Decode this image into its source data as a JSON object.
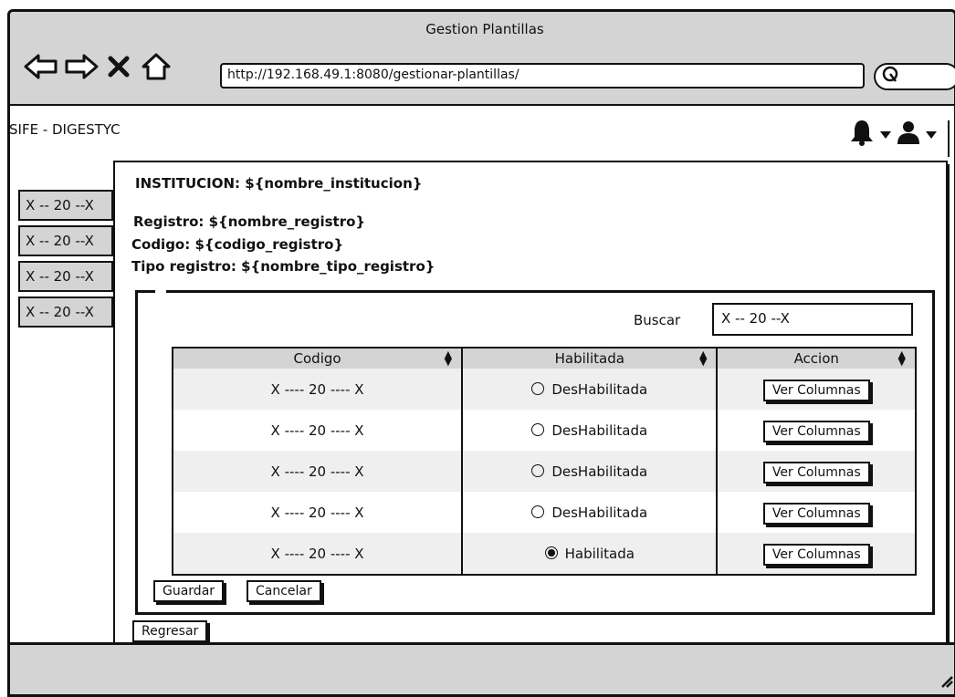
{
  "window": {
    "title": "Gestion Plantillas",
    "url": "http://192.168.49.1:8080/gestionar-plantillas/"
  },
  "app": {
    "title": "SIFE - DIGESTYC"
  },
  "side_tabs": [
    "X -- 20 --X",
    "X -- 20 --X",
    "X -- 20 --X",
    "X -- 20 --X"
  ],
  "info": {
    "institucion": "INSTITUCION: ${nombre_institucion}",
    "registro": "Registro: ${nombre_registro}",
    "codigo": "Codigo: ${codigo_registro}",
    "tipo": "Tipo registro: ${nombre_tipo_registro}"
  },
  "search": {
    "label": "Buscar",
    "value": "X -- 20 --X"
  },
  "table": {
    "headers": [
      "Codigo",
      "Habilitada",
      "Accion"
    ],
    "rows": [
      {
        "codigo": "X ---- 20 ---- X",
        "estado": "DesHabilitada",
        "checked": false,
        "accion": "Ver Columnas"
      },
      {
        "codigo": "X ---- 20 ---- X",
        "estado": "DesHabilitada",
        "checked": false,
        "accion": "Ver Columnas"
      },
      {
        "codigo": "X ---- 20 ---- X",
        "estado": "DesHabilitada",
        "checked": false,
        "accion": "Ver Columnas"
      },
      {
        "codigo": "X ---- 20 ---- X",
        "estado": "DesHabilitada",
        "checked": false,
        "accion": "Ver Columnas"
      },
      {
        "codigo": "X ---- 20 ---- X",
        "estado": "Habilitada",
        "checked": true,
        "accion": "Ver Columnas"
      }
    ]
  },
  "buttons": {
    "guardar": "Guardar",
    "cancelar": "Cancelar",
    "regresar": "Regresar"
  },
  "icons": [
    "back-arrow-icon",
    "forward-arrow-icon",
    "close-icon",
    "home-icon",
    "search-icon",
    "bell-icon",
    "user-icon",
    "caret-down-icon",
    "resize-icon"
  ]
}
